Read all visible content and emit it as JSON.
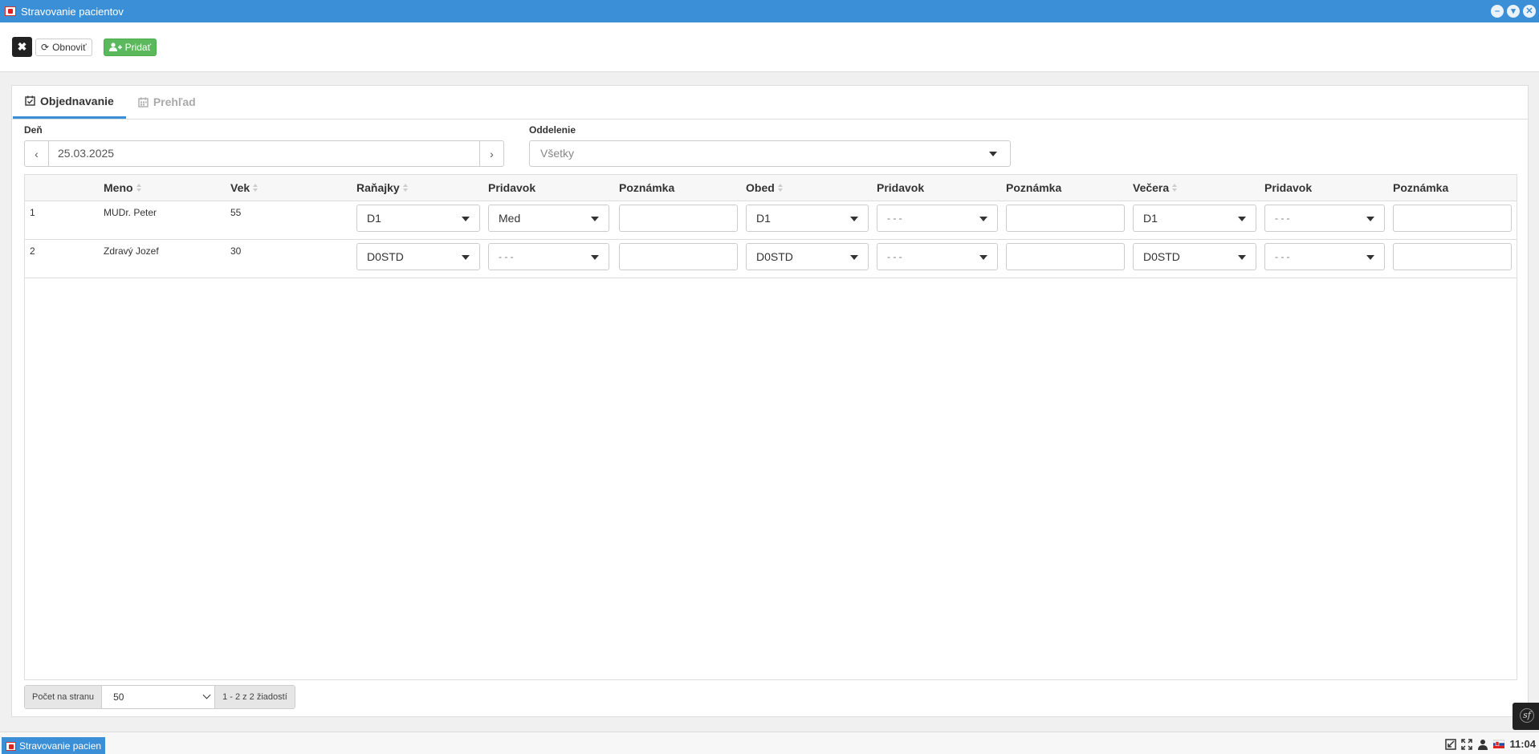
{
  "window": {
    "title": "Stravovanie pacientov"
  },
  "toolbar": {
    "refresh_label": "Obnoviť",
    "add_label": "Pridať"
  },
  "tabs": [
    {
      "label": "Objednavanie",
      "active": true
    },
    {
      "label": "Prehľad",
      "active": false
    }
  ],
  "filters": {
    "day_label": "Deň",
    "day_value": "25.03.2025",
    "dept_label": "Oddelenie",
    "dept_value": "Všetky"
  },
  "columns": [
    "Meno",
    "Vek",
    "Raňajky",
    "Pridavok",
    "Poznámka",
    "Obed",
    "Pridavok",
    "Poznámka",
    "Večera",
    "Pridavok",
    "Poznámka"
  ],
  "rows": [
    {
      "num": "1",
      "name": "MUDr. Peter",
      "age": "55",
      "breakfast": "D1",
      "breakfast_extra": "Med",
      "breakfast_note": "",
      "lunch": "D1",
      "lunch_extra": "- - -",
      "lunch_note": "",
      "dinner": "D1",
      "dinner_extra": "- - -",
      "dinner_note": ""
    },
    {
      "num": "2",
      "name": "Zdravý Jozef",
      "age": "30",
      "breakfast": "D0STD",
      "breakfast_extra": "- - -",
      "breakfast_note": "",
      "lunch": "D0STD",
      "lunch_extra": "- - -",
      "lunch_note": "",
      "dinner": "D0STD",
      "dinner_extra": "- - -",
      "dinner_note": ""
    }
  ],
  "pager": {
    "per_page_label": "Počet na stranu",
    "per_page_value": "50",
    "info": "1 - 2 z 2 žiadostí"
  },
  "taskbar": {
    "item_label": "Stravovanie pacien",
    "clock": "11:04"
  },
  "colors": {
    "accent": "#3a8fd6",
    "success": "#5cb85c"
  }
}
